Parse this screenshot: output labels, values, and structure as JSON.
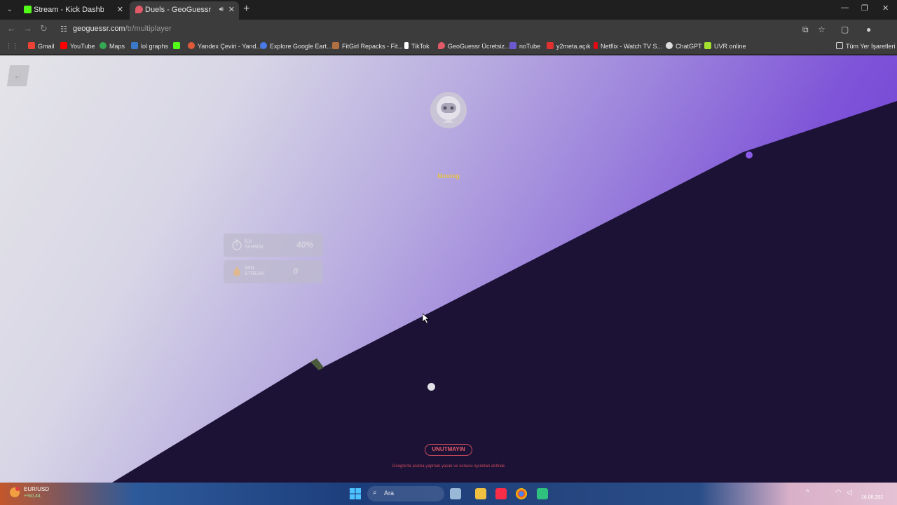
{
  "tabs": [
    {
      "label": "Stream - Kick Dashboard",
      "favicon": "kick-icon",
      "color": "#53fc18"
    },
    {
      "label": "Duels - GeoGuessr",
      "favicon": "geoguessr-icon",
      "color": "#e05a68",
      "active": true
    }
  ],
  "address_bar": {
    "domain": "geoguessr.com",
    "path": "/tr/multiplayer"
  },
  "bookmarks": [
    {
      "label": "Gmail",
      "icon": "gmail-icon",
      "color": "#ea4335"
    },
    {
      "label": "YouTube",
      "icon": "youtube-icon",
      "color": "#ff0000"
    },
    {
      "label": "Maps",
      "icon": "maps-icon",
      "color": "#34a853"
    },
    {
      "label": "lol graphs",
      "icon": "lolgraphs-icon",
      "color": "#3a78c8"
    },
    {
      "label": "",
      "icon": "kick-icon",
      "color": "#53fc18"
    },
    {
      "label": "Yandex Çeviri - Yand...",
      "icon": "yandex-icon",
      "color": "#e05a3a"
    },
    {
      "label": "Explore Google Eart...",
      "icon": "earth-icon",
      "color": "#4a7ae8"
    },
    {
      "label": "FitGirl Repacks - Fit...",
      "icon": "fitgirl-icon",
      "color": "#b07040"
    },
    {
      "label": "TikTok",
      "icon": "tiktok-icon",
      "color": "#ffffff"
    },
    {
      "label": "GeoGuessr Ücretsiz...",
      "icon": "geoguessr-icon",
      "color": "#e05a68"
    },
    {
      "label": "noTube",
      "icon": "notube-icon",
      "color": "#6a5acd"
    },
    {
      "label": "y2meta.açık",
      "icon": "y2meta-icon",
      "color": "#e03030"
    },
    {
      "label": "Netflix - Watch TV S...",
      "icon": "netflix-icon",
      "color": "#e50914"
    },
    {
      "label": "ChatGPT",
      "icon": "chatgpt-icon",
      "color": "#dddddd"
    },
    {
      "label": "UVR online",
      "icon": "uvr-icon",
      "color": "#a4e030"
    }
  ],
  "all_bookmarks": "Tüm Yer İşaretleri",
  "game": {
    "status": "Moving",
    "stats": [
      {
        "label_line1": "İLK",
        "label_line2": "TAHMİN",
        "value": "40%",
        "icon": "stopwatch-icon"
      },
      {
        "label_line1": "WIN",
        "label_line2": "STREAK",
        "value": "0",
        "icon": "flame-icon"
      }
    ],
    "reminder_title": "UNUTMAYIN",
    "reminder_text": "Google'da arama yapmak yasak ve sonucu oyundan atılmak"
  },
  "taskbar": {
    "currency_name": "EUR/USD",
    "currency_change": "+%0,44",
    "search_label": "Ara",
    "date": "16.08.202"
  },
  "colors": {
    "accent_dark": "#1b1236",
    "accent_purple": "#6a2fd4",
    "reminder_red": "#e05a68",
    "status_yellow": "#e8c44a"
  }
}
